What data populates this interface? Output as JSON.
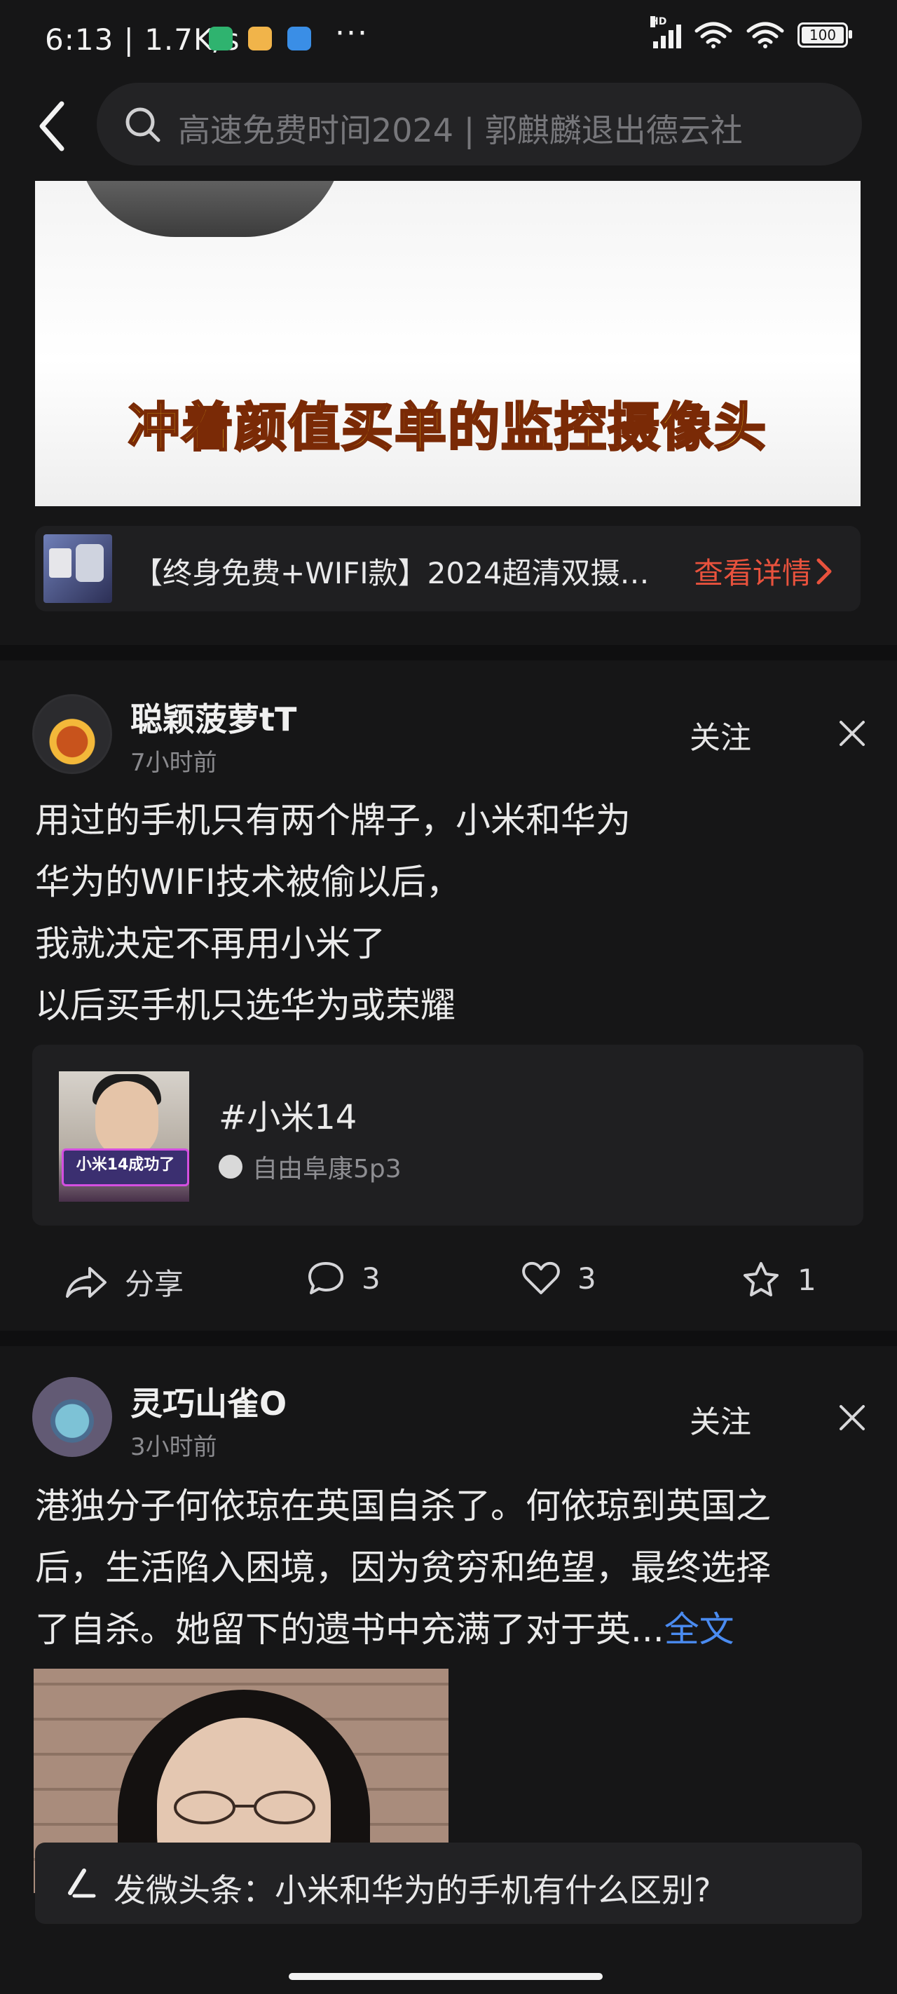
{
  "status_bar": {
    "time": "6:13",
    "speed": "1.7K/s",
    "battery": "100",
    "network": "HD"
  },
  "search": {
    "placeholder": "高速免费时间2024 | 郭麒麟退出德云社"
  },
  "ad": {
    "video_caption": "冲着颜值买单的监控摄像头",
    "product_title": "【终身免费+WIFI款】2024超清双摄…",
    "cta_label": "查看详情",
    "cta_color": "#e8523d"
  },
  "posts": [
    {
      "username": "聪颖菠萝tT",
      "time": "7小时前",
      "follow_label": "关注",
      "lines": [
        "用过的手机只有两个牌子，小米和华为",
        "华为的WIFI技术被偷以后，",
        "我就决定不再用小米了",
        "以后买手机只选华为或荣耀"
      ],
      "topic": {
        "tag": "#小米14",
        "thumb_caption": "小米14成功了",
        "source": "自由阜康5p3"
      },
      "actions": {
        "share": "分享",
        "comments": "3",
        "likes": "3",
        "favorites": "1"
      }
    },
    {
      "username": "灵巧山雀O",
      "time": "3小时前",
      "follow_label": "关注",
      "lines": [
        "港独分子何依琼在英国自杀了。何依琼到英国之",
        "后，生活陷入困境，因为贫穷和绝望，最终选择",
        "了自杀。她留下的遗书中充满了对于英..."
      ],
      "more_label": "全文",
      "more_color": "#4a8bf0"
    }
  ],
  "compose": {
    "prompt": "发微头条：小米和华为的手机有什么区别?"
  }
}
